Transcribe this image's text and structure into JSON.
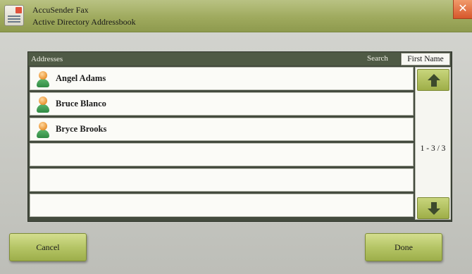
{
  "window": {
    "app_name": "AccuSender Fax",
    "subtitle": "Active Directory Addressbook",
    "close_glyph": "✕"
  },
  "list": {
    "header": "Addresses",
    "search_label": "Search",
    "sort_field": "First Name",
    "rows": [
      {
        "name": "Angel Adams",
        "icon": "person-icon"
      },
      {
        "name": "Bruce Blanco",
        "icon": "person-icon"
      },
      {
        "name": "Bryce Brooks",
        "icon": "person-icon"
      },
      {
        "name": ""
      },
      {
        "name": ""
      },
      {
        "name": ""
      }
    ],
    "page_indicator": "1 - 3 / 3"
  },
  "buttons": {
    "cancel": "Cancel",
    "done": "Done"
  },
  "colors": {
    "accent": "#a9b85a",
    "close": "#e06a3a"
  }
}
